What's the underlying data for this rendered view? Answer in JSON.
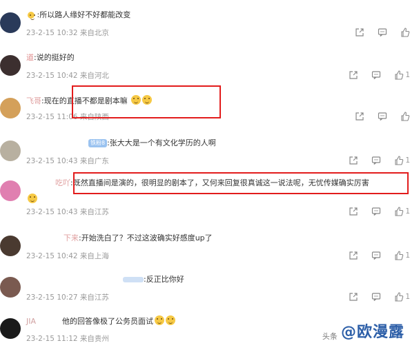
{
  "comments": [
    {
      "name": "",
      "badge": "",
      "text": ":所以路人缘好不好都能改变",
      "date": "23-2-15 10:32",
      "location": "来自北京",
      "like_count": "",
      "avatar_color": "#2a3a5a",
      "emojis": 0
    },
    {
      "name": "道",
      "badge": "",
      "text": ":说的挺好的",
      "date": "23-2-15 10:42",
      "location": "来自河北",
      "like_count": "1",
      "avatar_color": "#3c2f2f",
      "emojis": 0
    },
    {
      "name": "飞哥",
      "badge": "",
      "text": ":现在的直播不都是剧本嘛",
      "date": "23-2-15 11:06",
      "location": "来自陕西",
      "like_count": "",
      "avatar_color": "#d4a05a",
      "emojis": 2
    },
    {
      "name": "",
      "badge": "铁粉8",
      "text": ":张大大是一个有文化学历的人啊",
      "date": "23-2-15 10:43",
      "location": "来自广东",
      "like_count": "1",
      "avatar_color": "#b8b0a0",
      "emojis": 0
    },
    {
      "name": "吃吖",
      "badge": "",
      "text": ":既然直播间是演的，很明显的剧本了，又何来回复很真诚这一说法呢，无忧传媒确实厉害",
      "date": "23-2-15 10:43",
      "location": "来自江苏",
      "like_count": "1",
      "avatar_color": "#e07fb0",
      "emojis": 1
    },
    {
      "name": "下来",
      "badge": "",
      "text": ":开始洗白了？不过这波确实好感度up了",
      "date": "23-2-15 10:42",
      "location": "来自上海",
      "like_count": "1",
      "avatar_color": "#4a3a30",
      "emojis": 0
    },
    {
      "name": "",
      "badge": "",
      "text": ":反正比你好",
      "date": "23-2-15 10:27",
      "location": "来自江苏",
      "like_count": "1",
      "avatar_color": "#7a5a50",
      "emojis": 0
    },
    {
      "name": "JIA",
      "badge": "",
      "text": "他的回答像极了公务员面试",
      "date": "23-2-15 11:12",
      "location": "来自贵州",
      "like_count": "",
      "avatar_color": "#1a1a1a",
      "emojis": 2
    }
  ],
  "icons": {
    "share": "share-icon",
    "comment": "comment-icon",
    "like": "thumbs-up-icon"
  },
  "watermark": {
    "small": "头条",
    "brand": "@欧漫露"
  },
  "colors": {
    "highlight_box": "#e21b1b",
    "meta_text": "#999999",
    "watermark": "#2d5fa8"
  }
}
